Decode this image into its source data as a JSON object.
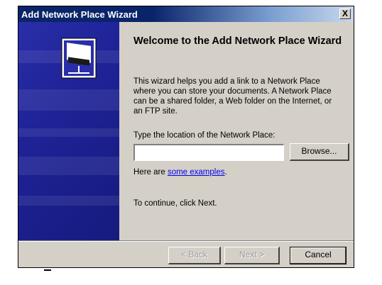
{
  "window": {
    "title": "Add Network Place Wizard",
    "close_label": "X"
  },
  "panel": {
    "icon": "network-drive-icon",
    "background_color": "#1e2296"
  },
  "content": {
    "heading": "Welcome to the Add Network Place Wizard",
    "description": "This wizard helps you add a link to a Network Place where you can store your documents. A Network Place can be a shared folder, a Web folder on the Internet, or an FTP site.",
    "location_label": "Type the location of the Network Place:",
    "location_value": "",
    "browse_label": "Browse...",
    "examples_prefix": "Here are ",
    "examples_link": "some examples",
    "examples_suffix": ".",
    "continue_text": "To continue, click Next."
  },
  "buttons": {
    "back": "< Back",
    "next": "Next >",
    "cancel": "Cancel"
  }
}
